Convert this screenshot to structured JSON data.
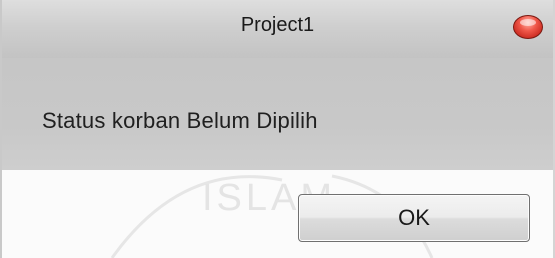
{
  "window": {
    "title": "Project1",
    "close_icon": "close-icon",
    "close_color": "#e0463a"
  },
  "message": {
    "text": "Status korban Belum Dipilih"
  },
  "buttons": {
    "ok_label": "OK"
  },
  "watermark": {
    "text": "ISLAM"
  }
}
